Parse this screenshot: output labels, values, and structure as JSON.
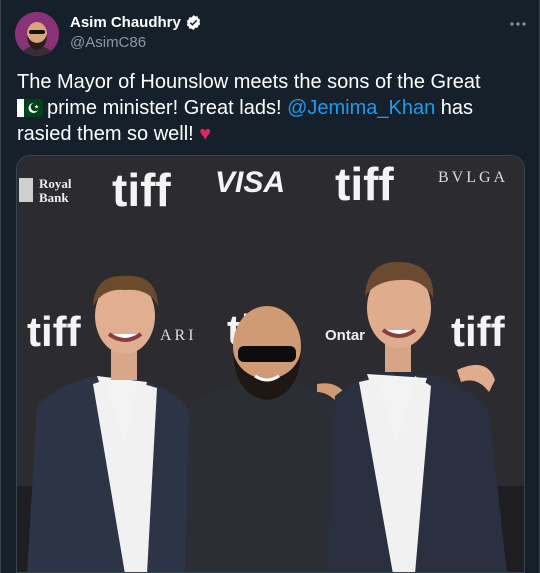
{
  "author": {
    "name": "Asim Chaudhry",
    "handle": "@AsimC86",
    "verified_icon": "verified-badge-icon",
    "avatar_icon": "avatar-illustration"
  },
  "more_menu_icon": "more-dots-icon",
  "tweet": {
    "line1": "The Mayor of Hounslow meets the sons of the Great",
    "line2_prefix": "prime minister! Great lads! ",
    "mention": "@Jemima_Khan",
    "line2_suffix": " has",
    "line3": "rasied them so well! ",
    "heart": "♥",
    "flag_icon": "pakistan-flag-icon"
  },
  "photo": {
    "logos": {
      "royal_bank": "Royal\nBank",
      "rbc": "RBC",
      "tiff": "tiff",
      "visa": "VISA",
      "bvlgari_partial": "BVLGA",
      "ari_partial": "ARI",
      "ontario_partial": "Ontar"
    }
  },
  "colors": {
    "background": "#15202b",
    "secondary_text": "#8899a6",
    "link": "#1d9bf0",
    "heart": "#e0245e"
  }
}
